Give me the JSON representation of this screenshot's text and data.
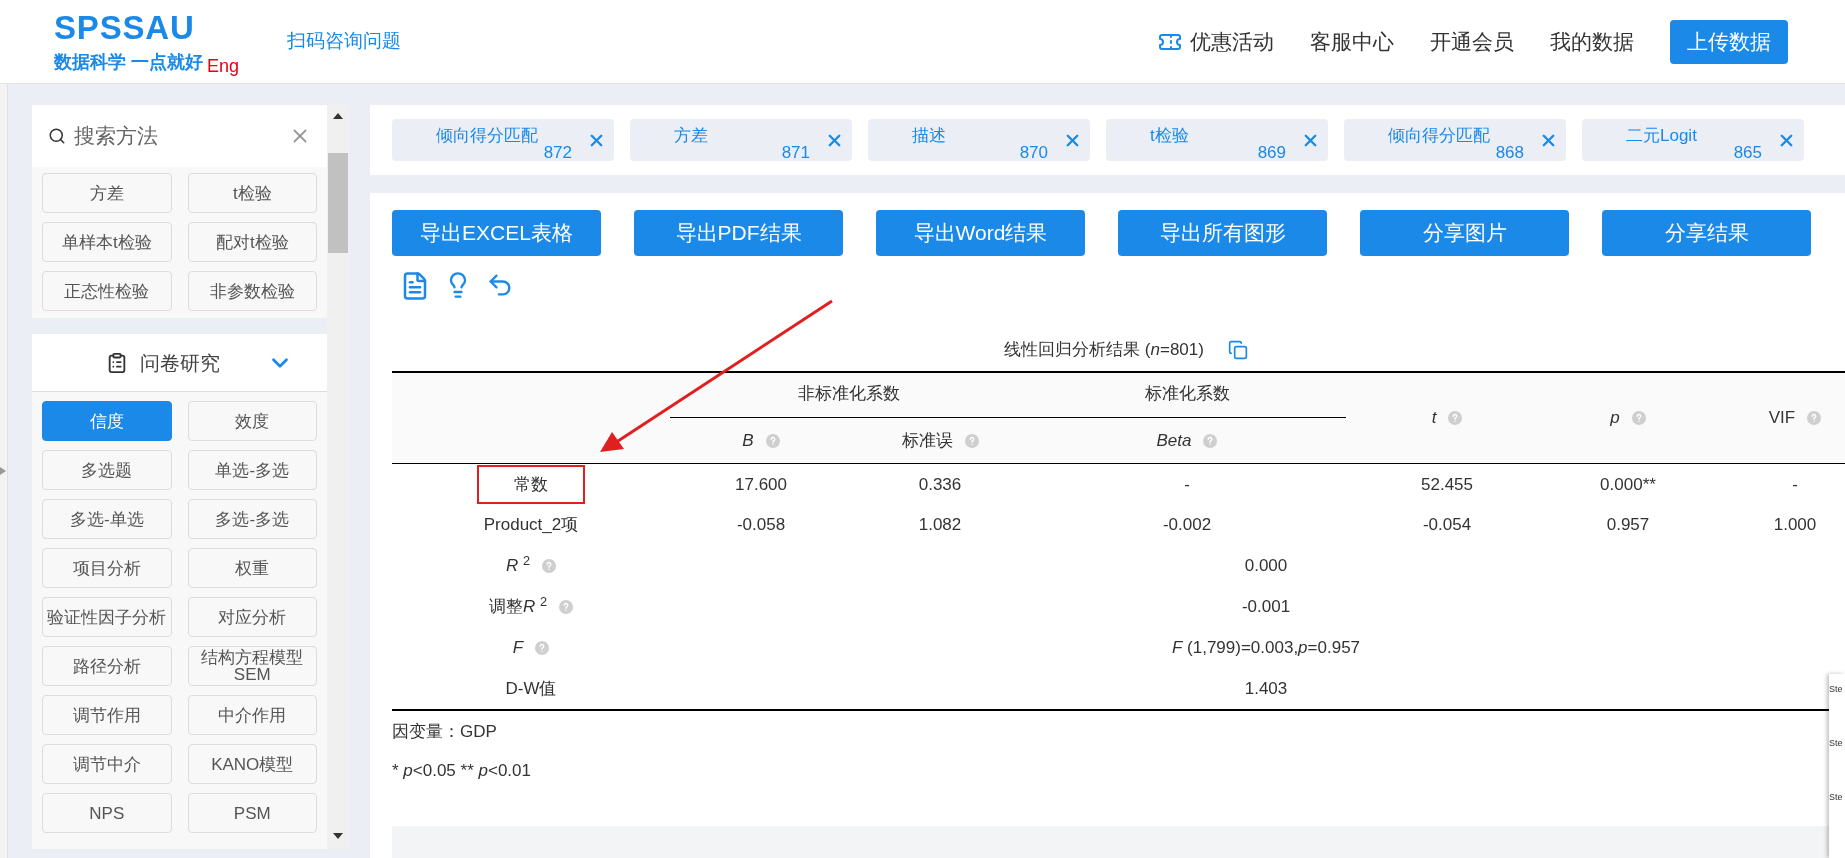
{
  "header": {
    "logo": "SPSSAU",
    "slogan": "数据科学 一点就好",
    "lang": "Eng",
    "consult_link": "扫码咨询问题",
    "nav": [
      {
        "label": "优惠活动",
        "kind": "promo"
      },
      {
        "label": "客服中心",
        "kind": "link"
      },
      {
        "label": "开通会员",
        "kind": "link"
      },
      {
        "label": "我的数据",
        "kind": "link"
      },
      {
        "label": "上传数据",
        "kind": "button"
      }
    ]
  },
  "sidebar": {
    "search": {
      "placeholder": "搜索方法"
    },
    "top_items": [
      {
        "label": "方差",
        "selected": false
      },
      {
        "label": "t检验",
        "selected": false
      },
      {
        "label": "单样本t检验",
        "selected": false
      },
      {
        "label": "配对t检验",
        "selected": false
      },
      {
        "label": "正态性检验",
        "selected": false
      },
      {
        "label": "非参数检验",
        "selected": false
      }
    ],
    "group": {
      "title": "问卷研究",
      "expanded": true,
      "items": [
        {
          "label": "信度",
          "selected": true
        },
        {
          "label": "效度",
          "selected": false
        },
        {
          "label": "多选题",
          "selected": false
        },
        {
          "label": "单选-多选",
          "selected": false
        },
        {
          "label": "多选-单选",
          "selected": false
        },
        {
          "label": "多选-多选",
          "selected": false
        },
        {
          "label": "项目分析",
          "selected": false
        },
        {
          "label": "权重",
          "selected": false
        },
        {
          "label": "验证性因子分析",
          "selected": false
        },
        {
          "label": "对应分析",
          "selected": false
        },
        {
          "label": "路径分析",
          "selected": false
        },
        {
          "label": "结构方程模型SEM",
          "selected": false
        },
        {
          "label": "调节作用",
          "selected": false
        },
        {
          "label": "中介作用",
          "selected": false
        },
        {
          "label": "调节中介",
          "selected": false
        },
        {
          "label": "KANO模型",
          "selected": false
        },
        {
          "label": "NPS",
          "selected": false
        },
        {
          "label": "PSM",
          "selected": false
        }
      ]
    }
  },
  "history_tabs": [
    {
      "label": "倾向得分匹配",
      "number": "872"
    },
    {
      "label": "方差",
      "number": "871"
    },
    {
      "label": "描述",
      "number": "870"
    },
    {
      "label": "t检验",
      "number": "869"
    },
    {
      "label": "倾向得分匹配",
      "number": "868"
    },
    {
      "label": "二元Logit",
      "number": "865"
    }
  ],
  "export_buttons": [
    "导出EXCEL表格",
    "导出PDF结果",
    "导出Word结果",
    "导出所有图形",
    "分享图片",
    "分享结果"
  ],
  "result": {
    "title": "线性回归分析结果 (*n*=801)",
    "column_groups": [
      {
        "label": "非标准化系数",
        "columns": [
          {
            "label": "B",
            "italic": true,
            "help": true
          },
          {
            "label": "标准误",
            "italic": false,
            "help": true
          }
        ]
      },
      {
        "label": "标准化系数",
        "columns": [
          {
            "label": "Beta",
            "italic": true,
            "help": true
          }
        ]
      }
    ],
    "columns": [
      {
        "label": "t",
        "italic": true,
        "help": true
      },
      {
        "label": "p",
        "italic": true,
        "help": true
      },
      {
        "label": "VIF",
        "italic": false,
        "help": true
      }
    ],
    "rows": [
      {
        "kind": "values",
        "label": "常数",
        "help": false,
        "highlighted": true,
        "cells": [
          "17.600",
          "0.336",
          "-",
          "52.455",
          "0.000**",
          "-"
        ]
      },
      {
        "kind": "values",
        "label": "Product_2项",
        "help": false,
        "highlighted": false,
        "cells": [
          "-0.058",
          "1.082",
          "-0.002",
          "-0.054",
          "0.957",
          "1.000"
        ]
      },
      {
        "kind": "merged",
        "label": "*R* $^{2}$",
        "help": true,
        "highlighted": false,
        "value": "0.000"
      },
      {
        "kind": "merged",
        "label_prefix": "调整",
        "label": "*R* $^{2}$",
        "help": true,
        "highlighted": false,
        "value": "-0.001"
      },
      {
        "kind": "merged",
        "label": "*F*",
        "help": true,
        "highlighted": false,
        "value": "*F* (1,799)=0.003,*p*=0.957"
      },
      {
        "kind": "merged",
        "label": "D-W值",
        "help": false,
        "highlighted": false,
        "value": "1.403"
      }
    ],
    "note": "因变量：GDP",
    "footnote": [
      {
        "text": "* ",
        "italic": false
      },
      {
        "text": "p",
        "italic": true
      },
      {
        "text": "<0.05 ** ",
        "italic": false
      },
      {
        "text": "p",
        "italic": true
      },
      {
        "text": "<0.01",
        "italic": false
      }
    ]
  },
  "annotation": {
    "arrow": true
  },
  "side_popup": {
    "items": [
      "Ste",
      "Ste",
      "Ste"
    ]
  }
}
